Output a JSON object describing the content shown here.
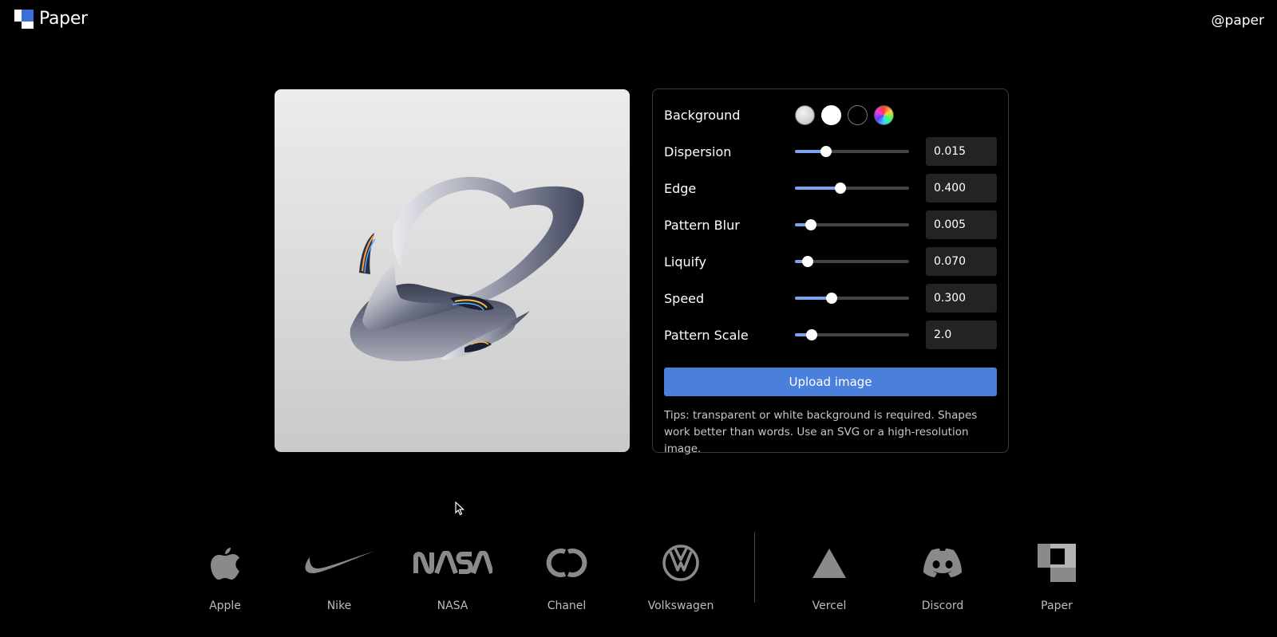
{
  "header": {
    "logo_text": "Paper",
    "handle": "@paper"
  },
  "controls": {
    "background_label": "Background",
    "swatches": [
      "metal",
      "white",
      "black",
      "rainbow"
    ],
    "sliders": [
      {
        "label": "Dispersion",
        "value": "0.015",
        "fill": 0.27
      },
      {
        "label": "Edge",
        "value": "0.400",
        "fill": 0.4
      },
      {
        "label": "Pattern Blur",
        "value": "0.005",
        "fill": 0.14
      },
      {
        "label": "Liquify",
        "value": "0.070",
        "fill": 0.11
      },
      {
        "label": "Speed",
        "value": "0.300",
        "fill": 0.32
      },
      {
        "label": "Pattern Scale",
        "value": "2.0",
        "fill": 0.15
      }
    ],
    "upload_label": "Upload image",
    "tips": "Tips: transparent or white background is required. Shapes work better than words. Use an SVG or a high-resolution image."
  },
  "brands": {
    "items": [
      {
        "name": "Apple",
        "icon": "apple-icon"
      },
      {
        "name": "Nike",
        "icon": "nike-icon"
      },
      {
        "name": "NASA",
        "icon": "nasa-icon"
      },
      {
        "name": "Chanel",
        "icon": "chanel-icon"
      },
      {
        "name": "Volkswagen",
        "icon": "volkswagen-icon"
      },
      {
        "name": "Vercel",
        "icon": "vercel-icon"
      },
      {
        "name": "Discord",
        "icon": "discord-icon"
      },
      {
        "name": "Paper",
        "icon": "paper-icon"
      }
    ]
  },
  "colors": {
    "accent": "#4b7fdc",
    "slider_fill": "#7da3ec",
    "panel_border": "#3a3a3a",
    "input_bg": "#232323"
  }
}
